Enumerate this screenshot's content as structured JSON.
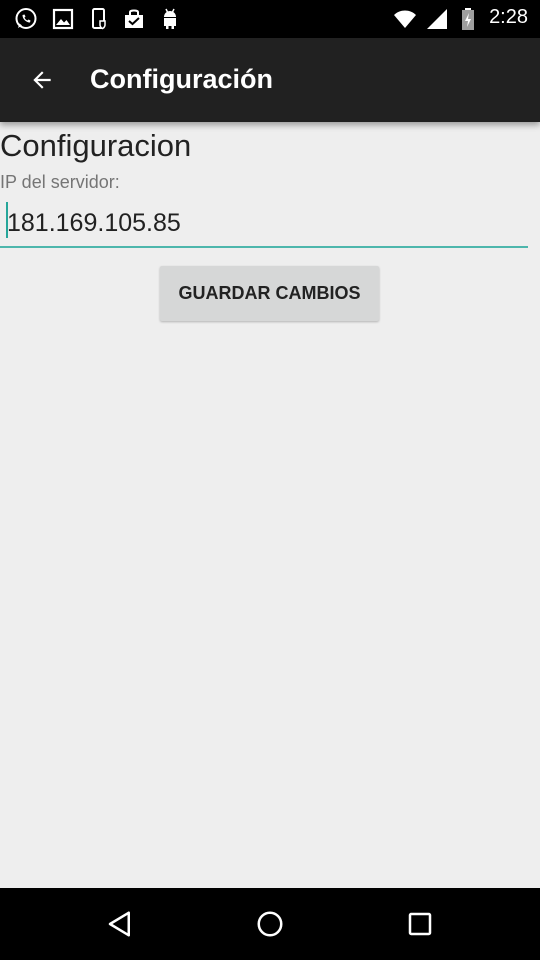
{
  "status_bar": {
    "time": "2:28",
    "left_icons": [
      "whatsapp-icon",
      "image-icon",
      "phone-shield-icon",
      "bag-icon",
      "android-icon"
    ],
    "right_icons": [
      "wifi-icon",
      "signal-icon",
      "battery-icon"
    ]
  },
  "app_bar": {
    "title": "Configuración",
    "background": "#212121"
  },
  "main": {
    "heading": "Configuracion",
    "ip_label": "IP del servidor:",
    "ip_value": "181.169.105.85",
    "save_button": "GUARDAR CAMBIOS"
  },
  "nav_bar": {
    "buttons": [
      "back-triangle-icon",
      "home-circle-icon",
      "recents-square-icon"
    ]
  },
  "colors": {
    "accent": "#4db6ac",
    "background": "#eeeeee"
  }
}
